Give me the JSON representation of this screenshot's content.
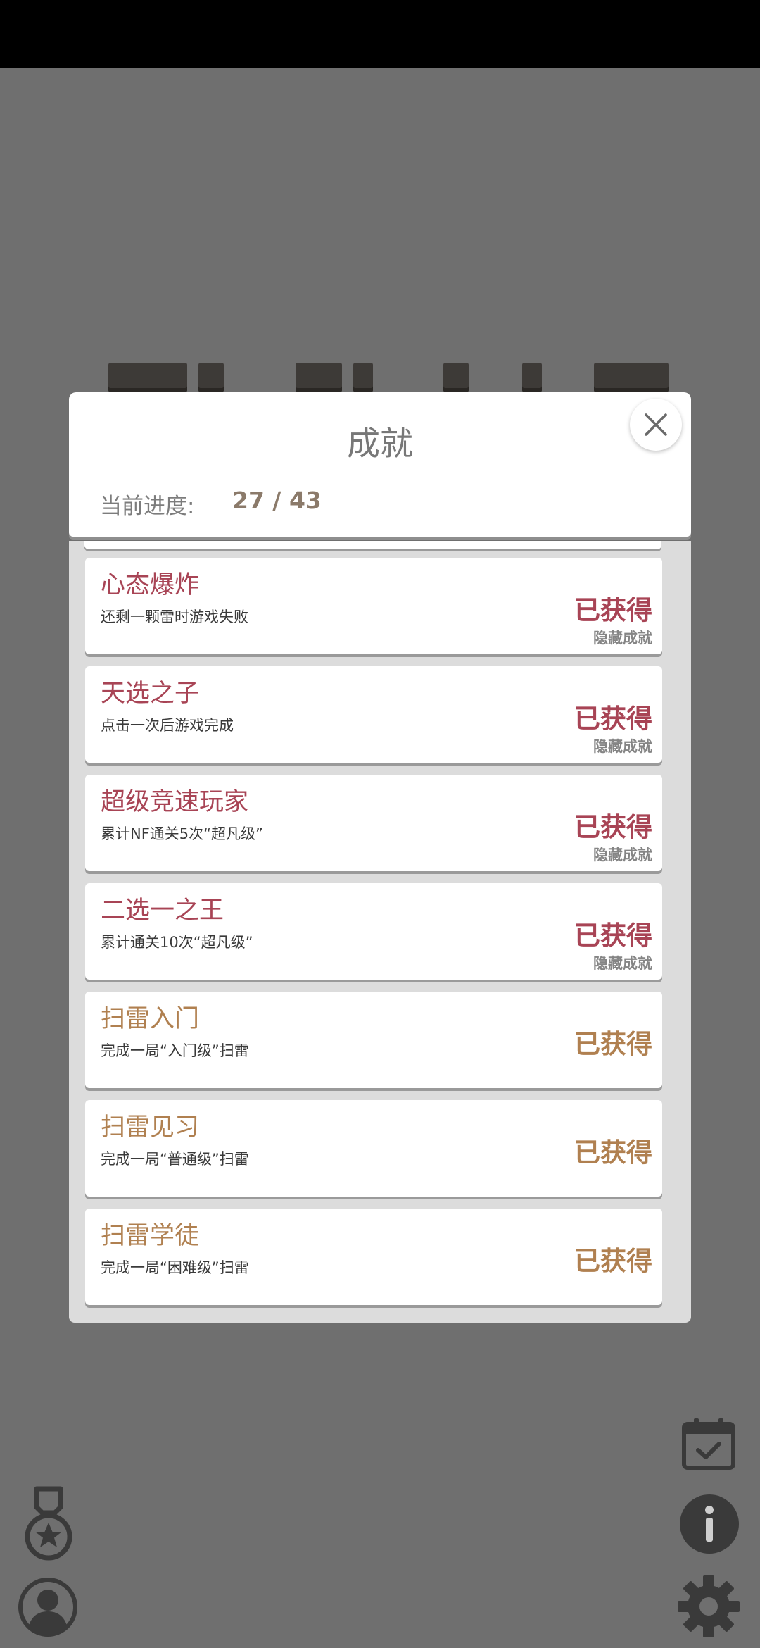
{
  "modal": {
    "title": "成就",
    "progress_label": "当前进度:",
    "progress_value": "27 / 43"
  },
  "achievements": [
    {
      "name": "心态爆炸",
      "desc": "还剩一颗雷时游戏失败",
      "status": "已获得",
      "tag": "隐藏成就",
      "kind": "hidden"
    },
    {
      "name": "天选之子",
      "desc": "点击一次后游戏完成",
      "status": "已获得",
      "tag": "隐藏成就",
      "kind": "hidden"
    },
    {
      "name": "超级竞速玩家",
      "desc": "累计NF通关5次“超凡级”",
      "status": "已获得",
      "tag": "隐藏成就",
      "kind": "hidden"
    },
    {
      "name": "二选一之王",
      "desc": "累计通关10次“超凡级”",
      "status": "已获得",
      "tag": "隐藏成就",
      "kind": "hidden"
    },
    {
      "name": "扫雷入门",
      "desc": "完成一局“入门级”扫雷",
      "status": "已获得",
      "tag": "",
      "kind": "normal"
    },
    {
      "name": "扫雷见习",
      "desc": "完成一局“普通级”扫雷",
      "status": "已获得",
      "tag": "",
      "kind": "normal"
    },
    {
      "name": "扫雷学徒",
      "desc": "完成一局“困难级”扫雷",
      "status": "已获得",
      "tag": "",
      "kind": "normal"
    }
  ],
  "colors": {
    "hidden_accent": "#a84455",
    "normal_accent": "#b08050",
    "backdrop": "#6f6f6f"
  },
  "icons": [
    "close-icon",
    "medal-icon",
    "profile-icon",
    "calendar-check-icon",
    "info-icon",
    "gear-icon"
  ]
}
